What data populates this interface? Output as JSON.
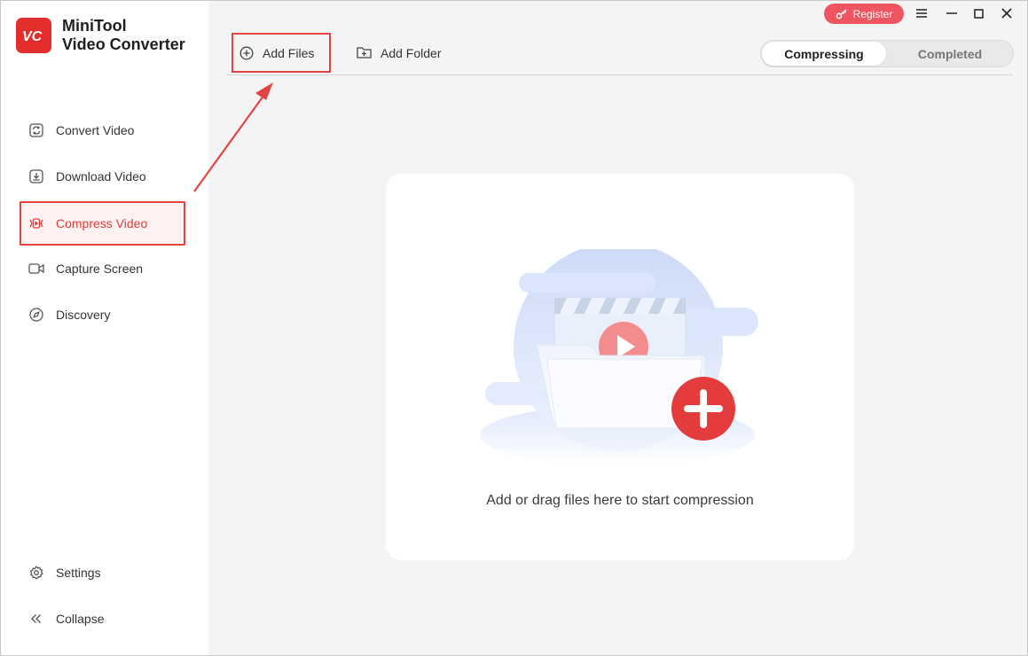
{
  "app": {
    "name_line1": "MiniTool",
    "name_line2": "Video Converter",
    "logo_text": "VC"
  },
  "titlebar": {
    "register_label": "Register"
  },
  "sidebar": {
    "items": [
      {
        "label": "Convert Video",
        "icon": "refresh-icon"
      },
      {
        "label": "Download Video",
        "icon": "download-icon"
      },
      {
        "label": "Compress Video",
        "icon": "compress-icon",
        "active": true
      },
      {
        "label": "Capture Screen",
        "icon": "camera-icon"
      },
      {
        "label": "Discovery",
        "icon": "compass-icon"
      }
    ],
    "bottom": [
      {
        "label": "Settings",
        "icon": "gear-icon"
      },
      {
        "label": "Collapse",
        "icon": "double-chevron-left-icon"
      }
    ]
  },
  "toolbar": {
    "add_files_label": "Add Files",
    "add_folder_label": "Add Folder",
    "tabs": [
      {
        "label": "Compressing",
        "active": true
      },
      {
        "label": "Completed",
        "active": false
      }
    ]
  },
  "dropzone": {
    "hint": "Add or drag files here to start compression"
  },
  "colors": {
    "accent": "#e42d2d",
    "register": "#ee5560",
    "highlight": "#e44343"
  }
}
